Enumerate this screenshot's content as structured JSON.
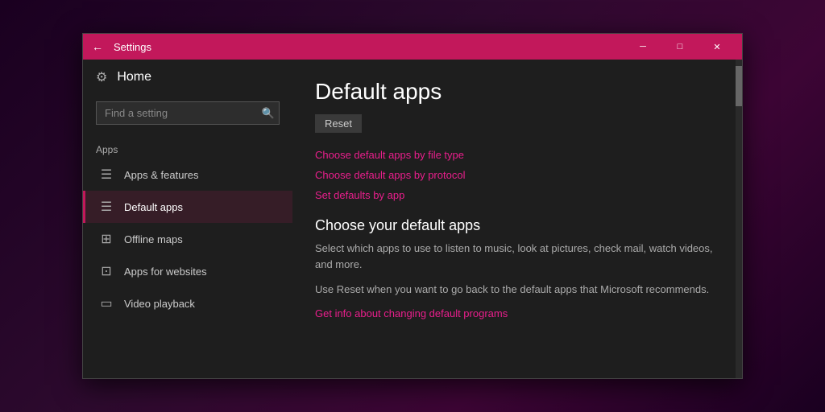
{
  "titlebar": {
    "back_icon": "←",
    "title": "Settings",
    "minimize_icon": "─",
    "maximize_icon": "□",
    "close_icon": "✕"
  },
  "sidebar": {
    "home_icon": "⚙",
    "home_label": "Home",
    "search_placeholder": "Find a setting",
    "search_icon": "🔍",
    "section_label": "Apps",
    "items": [
      {
        "id": "apps-features",
        "icon": "☰",
        "label": "Apps & features",
        "active": false
      },
      {
        "id": "default-apps",
        "icon": "☰",
        "label": "Default apps",
        "active": true
      },
      {
        "id": "offline-maps",
        "icon": "⊞",
        "label": "Offline maps",
        "active": false
      },
      {
        "id": "apps-websites",
        "icon": "⊡",
        "label": "Apps for websites",
        "active": false
      },
      {
        "id": "video-playback",
        "icon": "▭",
        "label": "Video playback",
        "active": false
      }
    ]
  },
  "main": {
    "page_title": "Default apps",
    "reset_button": "Reset",
    "links": [
      {
        "id": "file-type",
        "text": "Choose default apps by file type"
      },
      {
        "id": "protocol",
        "text": "Choose default apps by protocol"
      },
      {
        "id": "set-defaults",
        "text": "Set defaults by app"
      }
    ],
    "choose_title": "Choose your default apps",
    "choose_desc": "Select which apps to use to listen to music, look at pictures, check mail, watch videos, and more.",
    "reset_desc": "Use Reset when you want to go back to the default apps that Microsoft recommends.",
    "get_info_link": "Get info about changing default programs"
  }
}
